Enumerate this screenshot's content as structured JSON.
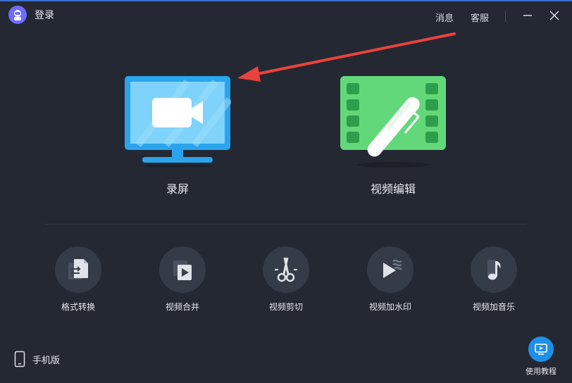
{
  "titlebar": {
    "login_label": "登录",
    "messages_label": "消息",
    "service_label": "客服"
  },
  "main": {
    "record": {
      "label": "录屏",
      "icon": "monitor-video-icon"
    },
    "edit": {
      "label": "视频编辑",
      "icon": "film-pen-icon"
    }
  },
  "tools": [
    {
      "label": "格式转换",
      "icon": "format-convert-icon"
    },
    {
      "label": "视频合并",
      "icon": "video-merge-icon"
    },
    {
      "label": "视频剪切",
      "icon": "scissors-icon"
    },
    {
      "label": "视频加水印",
      "icon": "watermark-icon"
    },
    {
      "label": "视频加音乐",
      "icon": "music-note-icon"
    }
  ],
  "footer": {
    "mobile_label": "手机版",
    "tutorial_label": "使用教程"
  },
  "colors": {
    "background": "#242833",
    "record_blue": "#2aa4ec",
    "edit_green": "#63d87a",
    "annotation_arrow": "#e8433e",
    "tutorial_blue": "#1e90e8"
  }
}
